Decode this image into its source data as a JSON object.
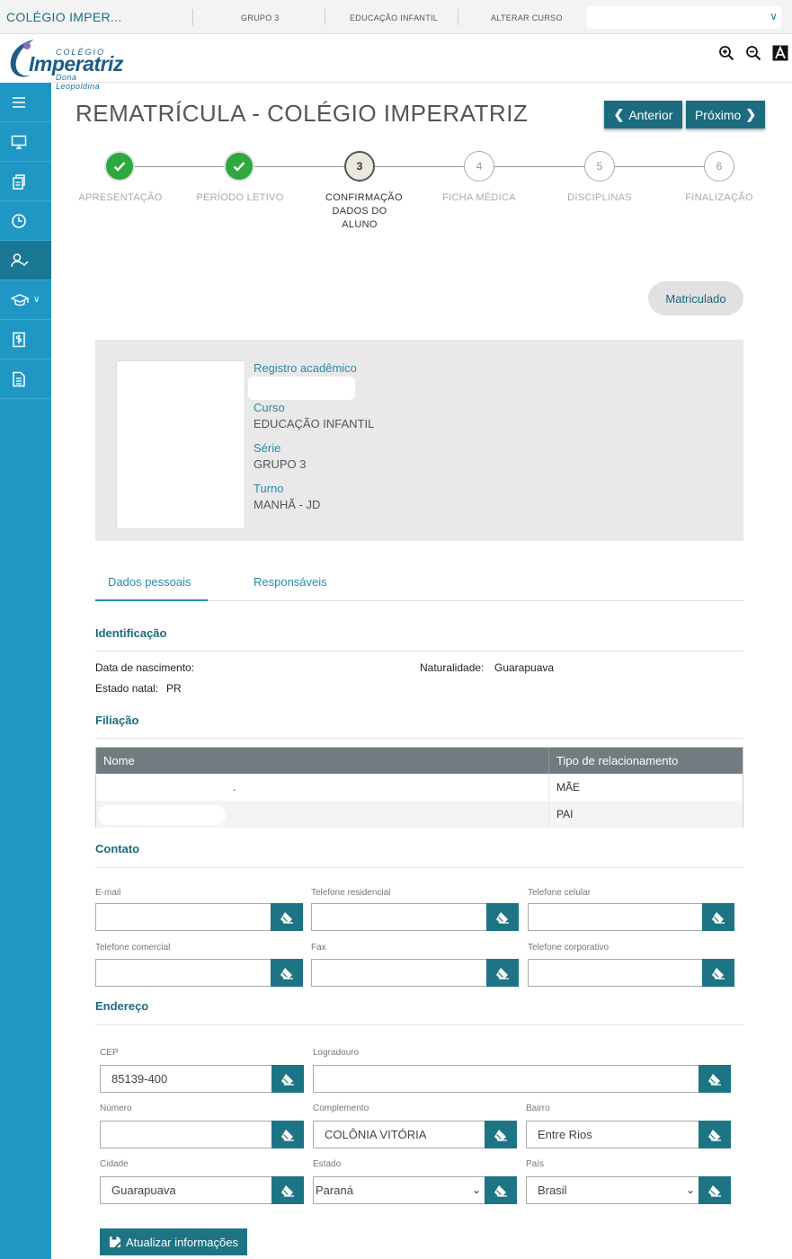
{
  "topbar": {
    "school": "COLÉGIO IMPER...",
    "nav": [
      "GRUPO 3",
      "EDUCAÇÃO INFANTIL",
      "ALTERAR CURSO"
    ],
    "select_value": ""
  },
  "logo": {
    "top": "COLÉGIO",
    "name": "Imperatriz",
    "sub": "Dona Leopoldina"
  },
  "accessibility": [
    "zoom-in-icon",
    "zoom-out-icon",
    "high-contrast-icon"
  ],
  "sidebar": {
    "items": [
      "menu-icon",
      "monitor-icon",
      "documents-icon",
      "clock-icon",
      "user-check-icon",
      "graduation-cap-icon",
      "finance-document-icon",
      "report-document-icon"
    ],
    "active_index": 4
  },
  "header": {
    "title": "REMATRÍCULA - COLÉGIO IMPERATRIZ",
    "prev_label": "Anterior",
    "next_label": "Próximo"
  },
  "steps": [
    {
      "number": "1",
      "label": "APRESENTAÇÃO",
      "state": "done"
    },
    {
      "number": "2",
      "label": "PERÍODO LETIVO",
      "state": "done"
    },
    {
      "number": "3",
      "label": "CONFIRMAÇÃO DADOS DO ALUNO",
      "state": "current"
    },
    {
      "number": "4",
      "label": "FICHA MÉDICA",
      "state": "todo"
    },
    {
      "number": "5",
      "label": "DISCIPLINAS",
      "state": "todo"
    },
    {
      "number": "6",
      "label": "FINALIZAÇÃO",
      "state": "todo"
    }
  ],
  "status_badge": "Matriculado",
  "student": {
    "registro_label": "Registro acadêmico",
    "registro_value": "",
    "curso_label": "Curso",
    "curso_value": "EDUCAÇÃO INFANTIL",
    "serie_label": "Série",
    "serie_value": "GRUPO 3",
    "turno_label": "Turno",
    "turno_value": "MANHÃ - JD"
  },
  "tabs": [
    "Dados pessoais",
    "Responsáveis"
  ],
  "identificacao": {
    "heading": "Identificação",
    "nascimento_label": "Data de nascimento:",
    "nascimento_value": "",
    "naturalidade_label": "Naturalidade:",
    "naturalidade_value": "Guarapuava",
    "estado_label": "Estado natal:",
    "estado_value": "PR"
  },
  "filiacao": {
    "heading": "Filiação",
    "columns": [
      "Nome",
      "Tipo de relacionamento"
    ],
    "rows": [
      {
        "nome": ".",
        "tipo": "MÃE"
      },
      {
        "nome": "",
        "tipo": "PAI"
      }
    ]
  },
  "contato": {
    "heading": "Contato",
    "fields": [
      {
        "label": "E-mail",
        "value": ""
      },
      {
        "label": "Telefone residencial",
        "value": ""
      },
      {
        "label": "Telefone celular",
        "value": ""
      },
      {
        "label": "Telefone comercial",
        "value": ""
      },
      {
        "label": "Fax",
        "value": ""
      },
      {
        "label": "Telefone corporativo",
        "value": ""
      }
    ]
  },
  "endereco": {
    "heading": "Endereço",
    "fields": [
      {
        "label": "CEP",
        "value": "85139-400"
      },
      {
        "label": "Logradouro",
        "value": ""
      },
      {
        "label": "Número",
        "value": ""
      },
      {
        "label": "Complemento",
        "value": "COLÔNIA VITÓRIA"
      },
      {
        "label": "Bairro",
        "value": "Entre Rios"
      },
      {
        "label": "Cidade",
        "value": "Guarapuava"
      },
      {
        "label": "Estado",
        "value": "Paraná"
      },
      {
        "label": "País",
        "value": "Brasil"
      }
    ]
  },
  "update_button": "Atualizar informações",
  "colors": {
    "sidebar": "#1f97c4",
    "sidebar_active": "#1a7894",
    "primary": "#1c6b7e",
    "done": "#2ea83f"
  }
}
